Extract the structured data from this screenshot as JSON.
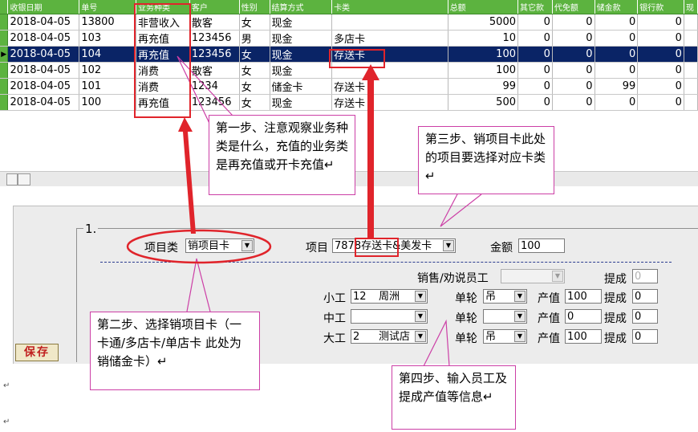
{
  "grid": {
    "columns": [
      "收银日期",
      "单号",
      "业务种类",
      "客户",
      "性别",
      "结算方式",
      "卡类",
      "总额",
      "其它款",
      "代免额",
      "储金款",
      "银行款",
      "现"
    ],
    "rows": [
      {
        "date": "2018-04-05",
        "no": "13800",
        "biz": "非营收入",
        "customer": "散客",
        "gender": "女",
        "pay": "现金",
        "card": "",
        "total": "5000",
        "other": "0",
        "free": "0",
        "store": "0",
        "bank": "0",
        "selected": false
      },
      {
        "date": "2018-04-05",
        "no": "103",
        "biz": "再充值",
        "customer": "123456",
        "gender": "男",
        "pay": "现金",
        "card": "多店卡",
        "total": "10",
        "other": "0",
        "free": "0",
        "store": "0",
        "bank": "0",
        "selected": false
      },
      {
        "date": "2018-04-05",
        "no": "104",
        "biz": "再充值",
        "customer": "123456",
        "gender": "女",
        "pay": "现金",
        "card": "存送卡",
        "total": "100",
        "other": "0",
        "free": "0",
        "store": "0",
        "bank": "0",
        "selected": true
      },
      {
        "date": "2018-04-05",
        "no": "102",
        "biz": "消费",
        "customer": "散客",
        "gender": "女",
        "pay": "现金",
        "card": "",
        "total": "100",
        "other": "0",
        "free": "0",
        "store": "0",
        "bank": "0",
        "selected": false
      },
      {
        "date": "2018-04-05",
        "no": "101",
        "biz": "消费",
        "customer": "1234",
        "gender": "女",
        "pay": "储金卡",
        "card": "存送卡",
        "total": "99",
        "other": "0",
        "free": "0",
        "store": "99",
        "bank": "0",
        "selected": false
      },
      {
        "date": "2018-04-05",
        "no": "100",
        "biz": "再充值",
        "customer": "123456",
        "gender": "女",
        "pay": "现金",
        "card": "存送卡",
        "total": "500",
        "other": "0",
        "free": "0",
        "store": "0",
        "bank": "0",
        "selected": false
      }
    ]
  },
  "form": {
    "group_label": "1.",
    "item_class_label": "项目类",
    "item_class_value": "销项目卡",
    "item_label": "项目",
    "item_value": "7878存送卡&美发卡",
    "amount_label": "金额",
    "amount_value": "100",
    "sales_staff_label": "销售/劝说员工",
    "commission_label": "提成",
    "commission_top_value": "0",
    "staff": [
      {
        "role": "小工",
        "value": "12",
        "name": "周洲",
        "unit_label": "单轮",
        "unit": "吊",
        "output_label": "产值",
        "output": "100",
        "commission_label": "提成",
        "commission": "0"
      },
      {
        "role": "中工",
        "value": "",
        "name": "",
        "unit_label": "单轮",
        "unit": "",
        "output_label": "产值",
        "output": "0",
        "commission_label": "提成",
        "commission": "0"
      },
      {
        "role": "大工",
        "value": "2",
        "name": "测试店",
        "unit_label": "单轮",
        "unit": "吊",
        "output_label": "产值",
        "output": "100",
        "commission_label": "提成",
        "commission": "0"
      }
    ],
    "save_label": "保存"
  },
  "callouts": {
    "step1": "第一步、注意观察业务种类是什么，充值的业务类是再充值或开卡充值↵",
    "step2": "第二步、选择销项目卡（一卡通/多店卡/单店卡  此处为销储金卡）↵",
    "step3": "第三步、销项目卡此处的项目要选择对应卡类↵",
    "step4": "第四步、输入员工及提成产值等信息↵"
  },
  "paragraph_mark": "↵",
  "colors": {
    "header_green": "#5cb33f",
    "selected_row": "#0a2466",
    "annotation_red": "#e0242b",
    "callout_border": "#cc3fa6"
  }
}
